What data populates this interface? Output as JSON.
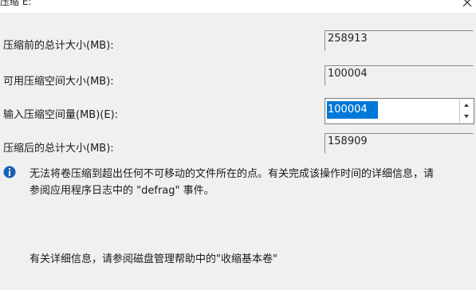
{
  "dialog": {
    "title": "压缩 E:",
    "close_icon": "close-icon"
  },
  "fields": {
    "total_before": {
      "label": "压缩前的总计大小(MB):",
      "value": "258913"
    },
    "available": {
      "label": "可用压缩空间大小(MB):",
      "value": "100004"
    },
    "shrink_amount": {
      "label": "输入压缩空间量(MB)(E):",
      "value": "100004"
    },
    "total_after": {
      "label": "压缩后的总计大小(MB):",
      "value": "158909"
    }
  },
  "info": {
    "icon": "info-icon",
    "icon_color": "#1a5fb4",
    "line1": "无法将卷压缩到超出任何不可移动的文件所在的点。有关完成该操作时间的详细信息，请",
    "line2": "参阅应用程序日志中的 \"defrag\" 事件。"
  },
  "help": {
    "text": "有关详细信息，请参阅磁盘管理帮助中的\"收缩基本卷\""
  },
  "colors": {
    "selection": "#0078d7",
    "background": "#f0f0f0"
  }
}
